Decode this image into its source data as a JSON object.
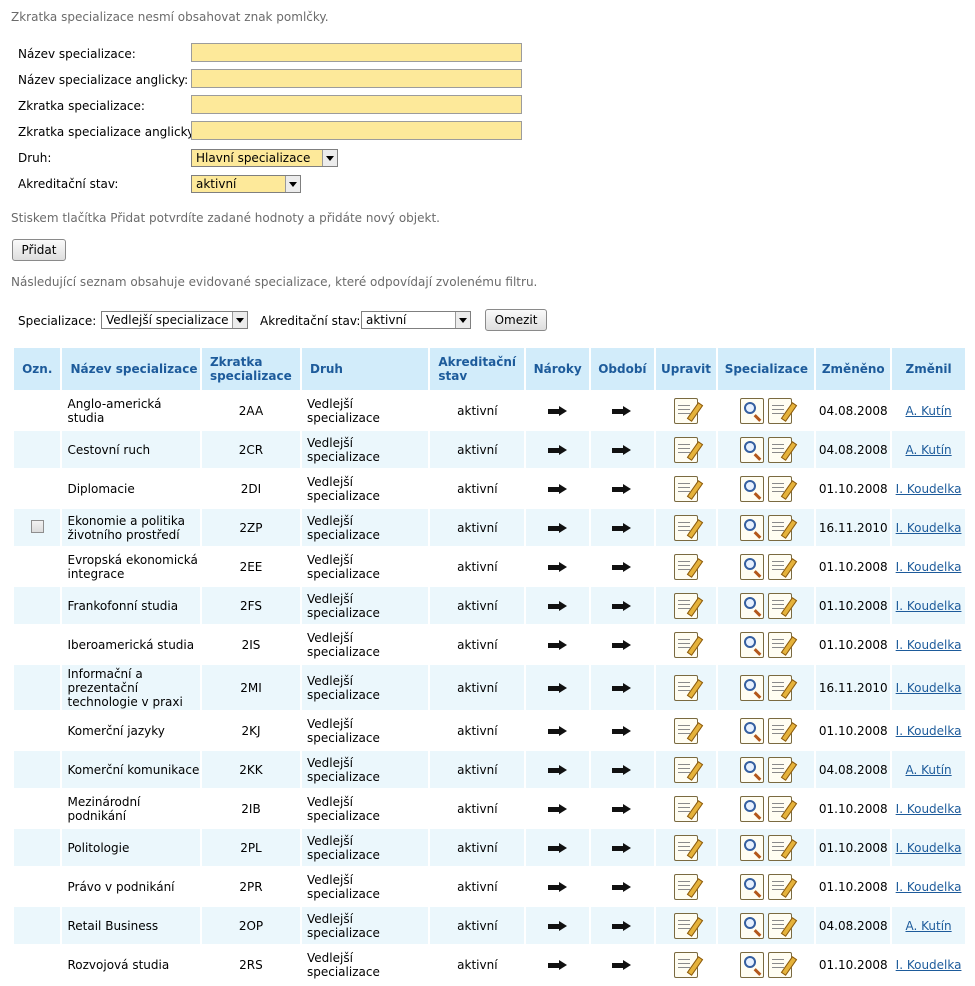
{
  "notes": {
    "abbr_warning": "Zkratka specializace nesmí obsahovat znak pomlčky.",
    "add_hint": "Stiskem tlačítka Přidat potvrdíte zadané hodnoty a přidáte nový objekt.",
    "list_hint": "Následující seznam obsahuje evidované specializace, které odpovídají zvolenému filtru."
  },
  "form": {
    "name_label": "Název specializace:",
    "name_value": "",
    "name_en_label": "Název specializace anglicky:",
    "name_en_value": "",
    "abbr_label": "Zkratka specializace:",
    "abbr_value": "",
    "abbr_en_label": "Zkratka specializace anglicky:",
    "abbr_en_value": "",
    "kind_label": "Druh:",
    "kind_value": "Hlavní specializace",
    "accred_label": "Akreditační stav:",
    "accred_value": "aktivní",
    "add_button": "Přidat"
  },
  "filter": {
    "spec_label": "Specializace:",
    "spec_value": "Vedlejší specializace",
    "accred_label": "Akreditační stav:",
    "accred_value": "aktivní",
    "limit_button": "Omezit"
  },
  "table": {
    "headers": {
      "ozn": "Ozn.",
      "name": "Název specializace",
      "abbr": "Zkratka specializace",
      "kind": "Druh",
      "accred": "Akreditační stav",
      "claims": "Nároky",
      "periods": "Období",
      "edit": "Upravit",
      "spec": "Specializace",
      "changed": "Změněno",
      "changer": "Změnil"
    },
    "rows": [
      {
        "name": "Anglo-americká studia",
        "abbr": "2AA",
        "kind": "Vedlejší specializace",
        "accred": "aktivní",
        "changed": "04.08.2008",
        "changer": "A. Kutín",
        "checkbox": false
      },
      {
        "name": "Cestovní ruch",
        "abbr": "2CR",
        "kind": "Vedlejší specializace",
        "accred": "aktivní",
        "changed": "04.08.2008",
        "changer": "A. Kutín",
        "checkbox": false
      },
      {
        "name": "Diplomacie",
        "abbr": "2DI",
        "kind": "Vedlejší specializace",
        "accred": "aktivní",
        "changed": "01.10.2008",
        "changer": "I. Koudelka",
        "checkbox": false
      },
      {
        "name": "Ekonomie a politika životního prostředí",
        "abbr": "2ZP",
        "kind": "Vedlejší specializace",
        "accred": "aktivní",
        "changed": "16.11.2010",
        "changer": "I. Koudelka",
        "checkbox": true
      },
      {
        "name": "Evropská ekonomická integrace",
        "abbr": "2EE",
        "kind": "Vedlejší specializace",
        "accred": "aktivní",
        "changed": "01.10.2008",
        "changer": "I. Koudelka",
        "checkbox": false
      },
      {
        "name": "Frankofonní studia",
        "abbr": "2FS",
        "kind": "Vedlejší specializace",
        "accred": "aktivní",
        "changed": "01.10.2008",
        "changer": "I. Koudelka",
        "checkbox": false
      },
      {
        "name": "Iberoamerická studia",
        "abbr": "2IS",
        "kind": "Vedlejší specializace",
        "accred": "aktivní",
        "changed": "01.10.2008",
        "changer": "I. Koudelka",
        "checkbox": false
      },
      {
        "name": "Informační a prezentační technologie v praxi",
        "abbr": "2MI",
        "kind": "Vedlejší specializace",
        "accred": "aktivní",
        "changed": "16.11.2010",
        "changer": "I. Koudelka",
        "checkbox": false
      },
      {
        "name": "Komerční jazyky",
        "abbr": "2KJ",
        "kind": "Vedlejší specializace",
        "accred": "aktivní",
        "changed": "01.10.2008",
        "changer": "I. Koudelka",
        "checkbox": false
      },
      {
        "name": "Komerční komunikace",
        "abbr": "2KK",
        "kind": "Vedlejší specializace",
        "accred": "aktivní",
        "changed": "04.08.2008",
        "changer": "A. Kutín",
        "checkbox": false
      },
      {
        "name": "Mezinárodní podnikání",
        "abbr": "2IB",
        "kind": "Vedlejší specializace",
        "accred": "aktivní",
        "changed": "01.10.2008",
        "changer": "I. Koudelka",
        "checkbox": false
      },
      {
        "name": "Politologie",
        "abbr": "2PL",
        "kind": "Vedlejší specializace",
        "accred": "aktivní",
        "changed": "01.10.2008",
        "changer": "I. Koudelka",
        "checkbox": false
      },
      {
        "name": "Právo v podnikání",
        "abbr": "2PR",
        "kind": "Vedlejší specializace",
        "accred": "aktivní",
        "changed": "01.10.2008",
        "changer": "I. Koudelka",
        "checkbox": false
      },
      {
        "name": "Retail Business",
        "abbr": "2OP",
        "kind": "Vedlejší specializace",
        "accred": "aktivní",
        "changed": "04.08.2008",
        "changer": "A. Kutín",
        "checkbox": false
      },
      {
        "name": "Rozvojová studia",
        "abbr": "2RS",
        "kind": "Vedlejší specializace",
        "accred": "aktivní",
        "changed": "01.10.2008",
        "changer": "I. Koudelka",
        "checkbox": false
      }
    ]
  },
  "icons": {
    "claims": "arrow-right-icon",
    "periods": "arrow-right-icon",
    "edit": "edit-note-icon",
    "spec_view": "magnifier-icon",
    "spec_edit": "edit-note-icon"
  },
  "colors": {
    "header_bg": "#d2ecfa",
    "header_text": "#1d5b9b",
    "row_alt": "#ebf7fc",
    "input_bg": "#fde99a",
    "link": "#1d5b9b"
  }
}
